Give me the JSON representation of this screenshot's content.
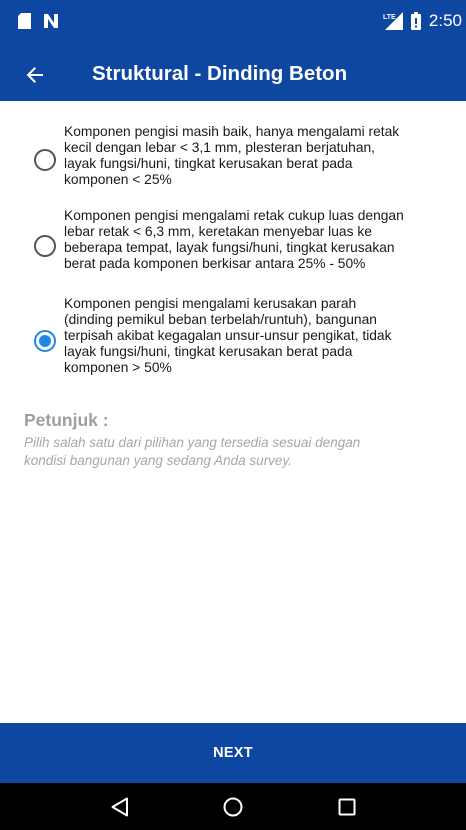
{
  "status_bar": {
    "time": "2:50",
    "network_label": "LTE",
    "icons": [
      "sd-card-icon",
      "n-notification-icon",
      "lte-signal-icon",
      "battery-icon"
    ]
  },
  "app_bar": {
    "back_icon": "arrow-back-icon",
    "title": "Struktural - Dinding Beton"
  },
  "options": [
    {
      "selected": false,
      "lines": [
        "Komponen pengisi masih baik, hanya mengalami retak",
        "kecil dengan lebar < 3,1 mm, plesteran berjatuhan,",
        "layak fungsi/huni, tingkat kerusakan berat pada",
        "komponen < 25%"
      ]
    },
    {
      "selected": false,
      "lines": [
        "Komponen pengisi mengalami retak cukup luas dengan",
        "lebar retak < 6,3 mm, keretakan menyebar luas ke",
        "beberapa tempat, layak fungsi/huni, tingkat kerusakan",
        "berat pada komponen berkisar antara 25% - 50%"
      ]
    },
    {
      "selected": true,
      "lines": [
        "Komponen pengisi mengalami kerusakan parah",
        "(dinding pemikul beban terbelah/runtuh), bangunan",
        "terpisah akibat kegagalan unsur-unsur pengikat, tidak",
        "layak fungsi/huni, tingkat kerusakan berat pada",
        "komponen > 50%"
      ]
    }
  ],
  "hint": {
    "title": "Petunjuk :",
    "lines": [
      "Pilih salah satu dari pilihan yang tersedia sesuai dengan",
      "kondisi bangunan yang sedang Anda survey."
    ]
  },
  "next_button": {
    "label": "NEXT"
  },
  "nav_bar": {
    "buttons": [
      "back-triangle-icon",
      "home-circle-icon",
      "recents-square-icon"
    ]
  },
  "colors": {
    "primary": "#0d47a1",
    "radio_selected": "#1e88e5",
    "hint_text": "#9e9e9e"
  }
}
